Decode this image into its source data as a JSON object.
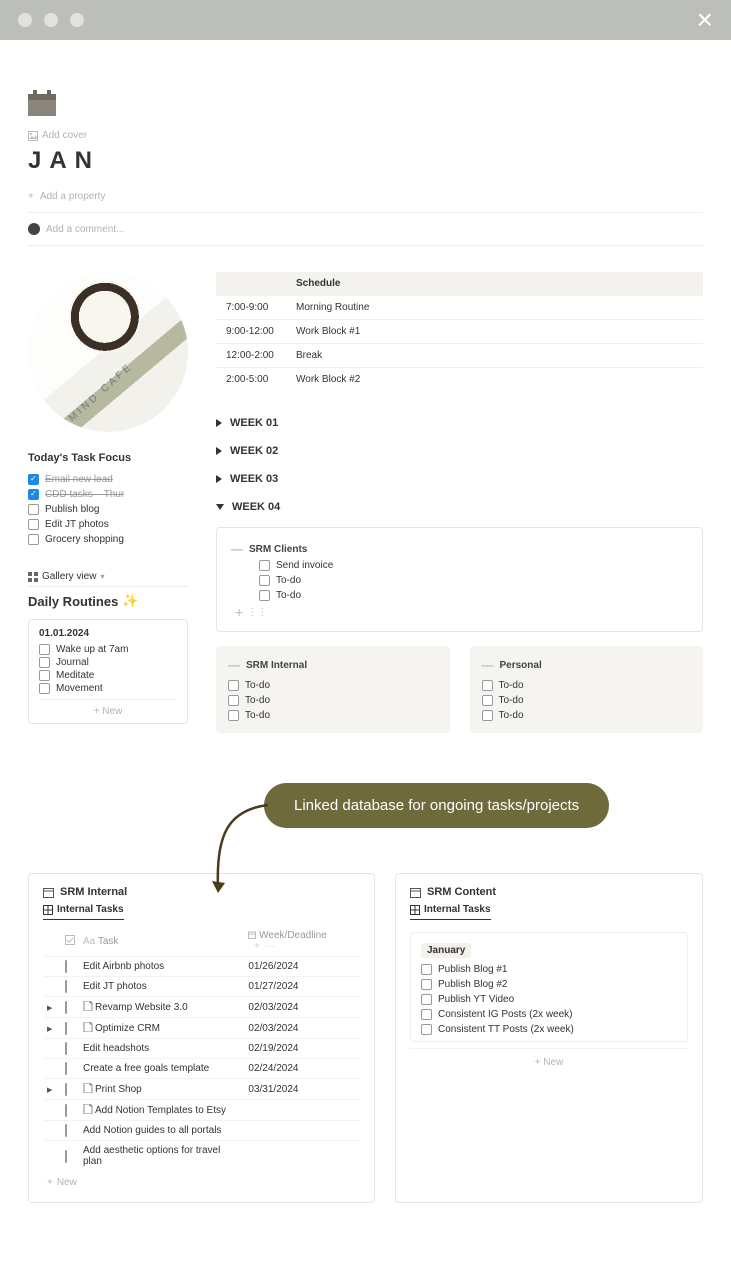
{
  "titlebar": {
    "close_label": "×"
  },
  "header": {
    "add_cover": "Add cover",
    "title": "JAN",
    "add_property": "Add a property",
    "add_comment": "Add a comment..."
  },
  "focus": {
    "heading": "Today's Task Focus",
    "items": [
      {
        "label": "Email new lead",
        "checked": true
      },
      {
        "label": "CDD tasks – Thur",
        "checked": true
      },
      {
        "label": "Publish blog",
        "checked": false
      },
      {
        "label": "Edit JT photos",
        "checked": false
      },
      {
        "label": "Grocery shopping",
        "checked": false
      }
    ]
  },
  "gallery": {
    "view_label": "Gallery view",
    "title": "Daily Routines",
    "card_date": "01.01.2024",
    "card_items": [
      "Wake up at 7am",
      "Journal",
      "Meditate",
      "Movement"
    ],
    "new_label": "+  New"
  },
  "schedule": {
    "header_blank": "",
    "header_label": "Schedule",
    "rows": [
      {
        "time": "7:00-9:00",
        "entry": "Morning Routine"
      },
      {
        "time": "9:00-12:00",
        "entry": "Work Block #1"
      },
      {
        "time": "12:00-2:00",
        "entry": "Break"
      },
      {
        "time": "2:00-5:00",
        "entry": "Work Block #2"
      }
    ]
  },
  "weeks": [
    "WEEK 01",
    "WEEK 02",
    "WEEK 03",
    "WEEK 04"
  ],
  "week04": {
    "clients": {
      "title": "SRM Clients",
      "items": [
        "Send invoice",
        "To-do",
        "To-do"
      ]
    },
    "internal": {
      "title": "SRM Internal",
      "items": [
        "To-do",
        "To-do",
        "To-do"
      ]
    },
    "personal": {
      "title": "Personal",
      "items": [
        "To-do",
        "To-do",
        "To-do"
      ]
    }
  },
  "callout": {
    "text": "Linked database for ongoing tasks/projects"
  },
  "srm_internal": {
    "title": "SRM Internal",
    "tab": "Internal Tasks",
    "col1": "Task",
    "col2": "Week/Deadline",
    "rows": [
      {
        "toggle": false,
        "doc": false,
        "task": "Edit Airbnb photos",
        "date": "01/26/2024"
      },
      {
        "toggle": false,
        "doc": false,
        "task": "Edit JT photos",
        "date": "01/27/2024"
      },
      {
        "toggle": true,
        "doc": true,
        "task": "Revamp Website 3.0",
        "date": "02/03/2024"
      },
      {
        "toggle": true,
        "doc": true,
        "task": "Optimize CRM",
        "date": "02/03/2024"
      },
      {
        "toggle": false,
        "doc": false,
        "task": "Edit headshots",
        "date": "02/19/2024"
      },
      {
        "toggle": false,
        "doc": false,
        "task": "Create a free goals template",
        "date": "02/24/2024"
      },
      {
        "toggle": true,
        "doc": true,
        "task": "Print Shop",
        "date": "03/31/2024"
      },
      {
        "toggle": false,
        "doc": true,
        "task": "Add Notion Templates to Etsy",
        "date": ""
      },
      {
        "toggle": false,
        "doc": false,
        "task": "Add Notion guides to all portals",
        "date": ""
      },
      {
        "toggle": false,
        "doc": false,
        "task": "Add aesthetic options for travel plan",
        "date": ""
      }
    ],
    "new_label": "New"
  },
  "srm_content": {
    "title": "SRM Content",
    "tab": "Internal Tasks",
    "month": "January",
    "items": [
      "Publish Blog #1",
      "Publish Blog #2",
      "Publish YT Video",
      "Consistent IG Posts (2x week)",
      "Consistent TT Posts (2x week)"
    ],
    "new_label": "+  New"
  }
}
